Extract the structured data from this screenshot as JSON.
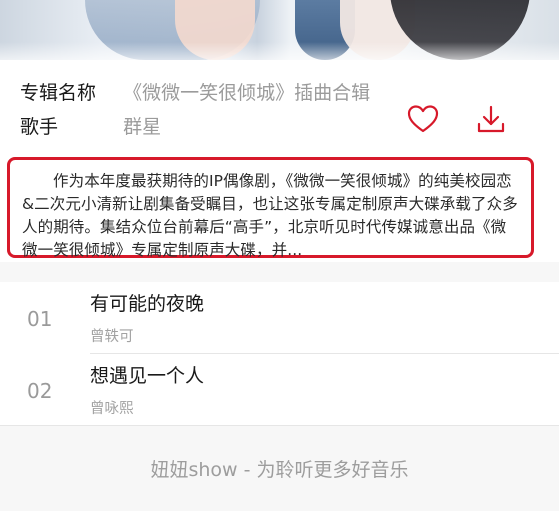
{
  "album": {
    "name_label": "专辑名称",
    "name_value": "《微微一笑很倾城》插曲合辑",
    "artist_label": "歌手",
    "artist_value": "群星",
    "accent_color": "#d7192a"
  },
  "actions": {
    "like_icon": "heart-outline-icon",
    "download_icon": "download-icon"
  },
  "description": {
    "text": "作为本年度最获期待的IP偶像剧，《微微一笑很倾城》的纯美校园恋&二次元小清新让剧集备受瞩目，也让这张专属定制原声大碟承载了众多人的期待。集结众位台前幕后“高手”，北京听见时代传媒诚意出品《微微一笑很倾城》专属定制原声大碟，并..."
  },
  "tracks": [
    {
      "index": "01",
      "title": "有可能的夜晚",
      "artist": "曾轶可"
    },
    {
      "index": "02",
      "title": "想遇见一个人",
      "artist": "曾咏熙"
    }
  ],
  "footer": {
    "text": "妞妞show - 为聆听更多好音乐"
  }
}
